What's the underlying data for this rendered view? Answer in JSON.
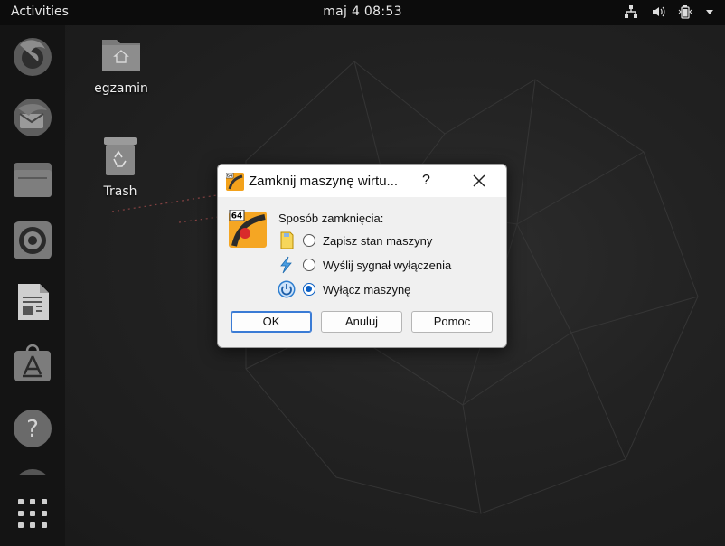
{
  "topbar": {
    "activities": "Activities",
    "clock": "maj 4  08:53",
    "tray": [
      "network-icon",
      "volume-icon",
      "battery-icon",
      "system-menu-arrow-icon"
    ]
  },
  "dock": {
    "items": [
      "firefox-icon",
      "thunderbird-icon",
      "files-icon",
      "rhythmbox-icon",
      "libreoffice-writer-icon",
      "app-center-icon",
      "help-icon",
      "show-apps-icon"
    ]
  },
  "desktop": {
    "icons": [
      {
        "label": "egzamin",
        "icon": "home-folder-icon"
      },
      {
        "label": "Trash",
        "icon": "trash-icon"
      }
    ]
  },
  "dialog": {
    "title": "Zamknij maszynę wirtu...",
    "help": "?",
    "heading": "Sposób zamknięcia:",
    "options": [
      {
        "label": "Zapisz stan maszyny",
        "selected": false,
        "icon": "save-state-icon"
      },
      {
        "label": "Wyślij sygnał wyłączenia",
        "selected": false,
        "icon": "acpi-signal-icon"
      },
      {
        "label": "Wyłącz maszynę",
        "selected": true,
        "icon": "power-icon"
      }
    ],
    "buttons": {
      "ok": "OK",
      "cancel": "Anuluj",
      "help": "Pomoc"
    },
    "accent": "#0a5fc4"
  }
}
